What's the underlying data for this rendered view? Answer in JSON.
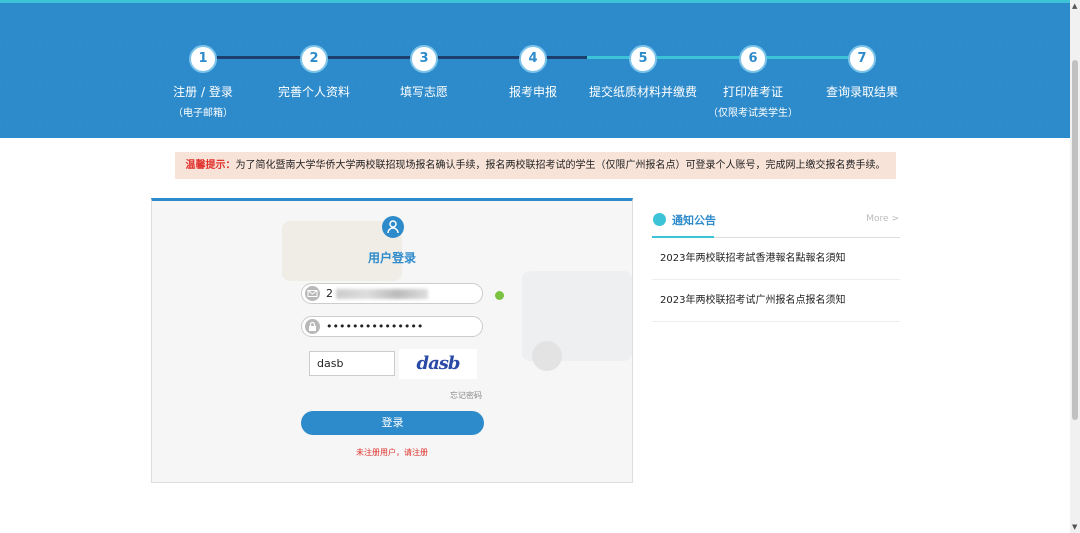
{
  "steps": [
    {
      "num": "1",
      "label": "注册 / 登录",
      "sub": "（电子邮箱）"
    },
    {
      "num": "2",
      "label": "完善个人资料",
      "sub": ""
    },
    {
      "num": "3",
      "label": "填写志愿",
      "sub": ""
    },
    {
      "num": "4",
      "label": "报考申报",
      "sub": ""
    },
    {
      "num": "5",
      "label": "提交纸质材料并缴费",
      "sub": ""
    },
    {
      "num": "6",
      "label": "打印准考证",
      "sub": "（仅限考试类学生）"
    },
    {
      "num": "7",
      "label": "查询录取结果",
      "sub": ""
    }
  ],
  "notice_bar": {
    "prefix": "温馨提示：",
    "text": "为了简化暨南大学华侨大学两校联招现场报名确认手续，报名两校联招考试的学生（仅限广州报名点）可登录个人账号，完成网上缴交报名费手续。"
  },
  "login": {
    "title": "用户登录",
    "email_value": "2",
    "password_value": "•••••••••••••••",
    "captcha_value": "dasb",
    "captcha_image_text": "dasb",
    "forgot": "忘记密码",
    "button": "登录",
    "register": "未注册用户，请注册"
  },
  "announcements": {
    "title": "通知公告",
    "more": "More >",
    "items": [
      {
        "text": "2023年两校联招考試香港報名點報名須知"
      },
      {
        "text": "2023年两校联招考试广州报名点报名须知"
      }
    ]
  },
  "colors": {
    "brand": "#2e8bcb",
    "accent": "#3cc3d8",
    "alert": "#e0312c"
  },
  "icons": {
    "user": "user-icon",
    "email": "email-icon",
    "lock": "lock-icon",
    "check": "check-icon",
    "announce": "speech-bubble-icon"
  }
}
